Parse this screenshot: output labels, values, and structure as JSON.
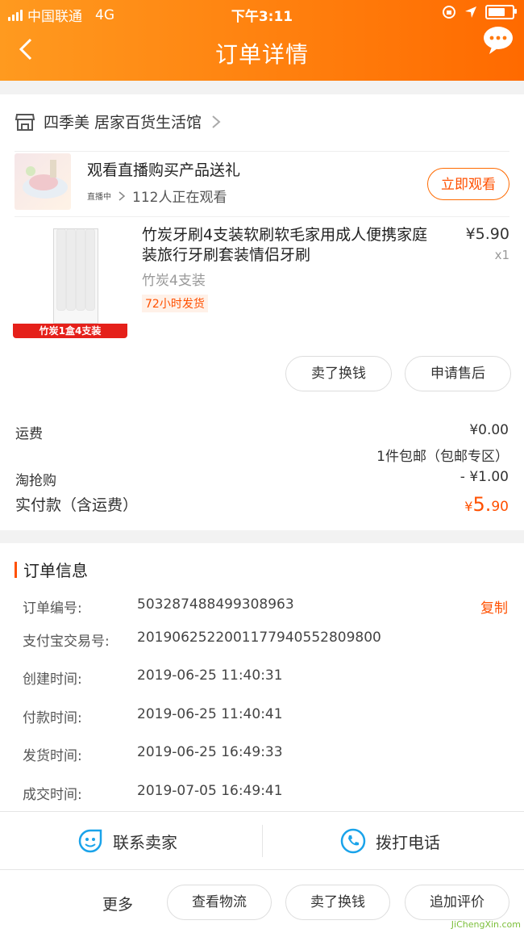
{
  "status_bar": {
    "carrier": "中国联通",
    "network": "4G",
    "time": "下午3:11",
    "battery_fill": 0.85
  },
  "header": {
    "title": "订单详情",
    "back_icon": "chevron-left-icon",
    "chat_icon": "chat-bubble-icon"
  },
  "store": {
    "name": "四季美 居家百货生活馆",
    "icon": "store-icon"
  },
  "live": {
    "title": "观看直播购买产品送礼",
    "tag": "直播中",
    "viewers": "112人正在观看",
    "button": "立即观看"
  },
  "product": {
    "title": "竹炭牙刷4支装软刷软毛家用成人便携家庭装旅行牙刷套装情侣牙刷",
    "price": "¥5.90",
    "qty": "x1",
    "spec": "竹炭4支装",
    "ship_tag": "72小时发货",
    "image_label": "竹炭1盒4支装",
    "actions": [
      "卖了换钱",
      "申请售后"
    ]
  },
  "fees": {
    "shipping_label": "运费",
    "shipping_value": "¥0.00",
    "shipping_note": "1件包邮（包邮专区）",
    "discount_label": "淘抢购",
    "discount_value": "- ¥1.00",
    "paid_label": "实付款（含运费）",
    "paid_currency": "¥",
    "paid_int": "5.",
    "paid_dec": "90"
  },
  "order_info": {
    "heading": "订单信息",
    "copy_label": "复制",
    "rows": [
      {
        "k": "订单编号:",
        "v": "503287488499308963"
      },
      {
        "k": "支付宝交易号:",
        "v": "2019062522001177940552809800"
      },
      {
        "k": "创建时间:",
        "v": "2019-06-25 11:40:31"
      },
      {
        "k": "付款时间:",
        "v": "2019-06-25 11:40:41"
      },
      {
        "k": "发货时间:",
        "v": "2019-06-25 16:49:33"
      },
      {
        "k": "成交时间:",
        "v": "2019-07-05 16:49:41"
      }
    ]
  },
  "contact": {
    "seller": "联系卖家",
    "phone": "拨打电话"
  },
  "footer": {
    "more": "更多",
    "buttons": [
      "查看物流",
      "卖了换钱",
      "追加评价"
    ]
  },
  "watermark": {
    "site": "JiChengXin.com"
  },
  "colors": {
    "accent": "#ff5000",
    "header_start": "#ff9a1f",
    "header_end": "#ff6a00",
    "contact_icon": "#1aa3ea"
  }
}
